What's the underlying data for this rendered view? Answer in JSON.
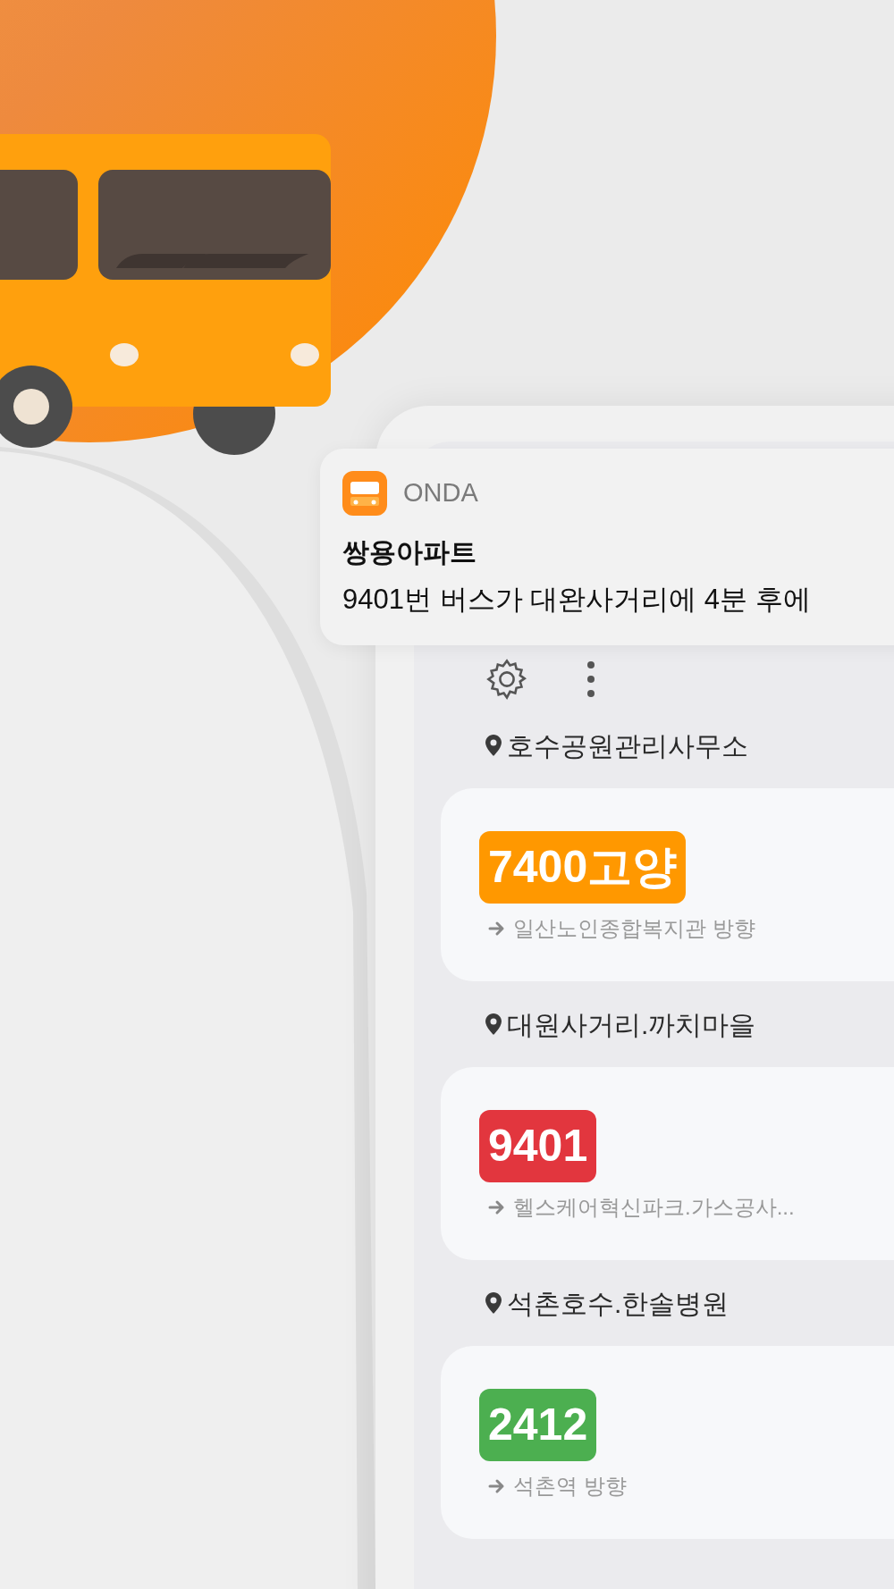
{
  "notification": {
    "app": "ONDA",
    "title": "쌍용아파트",
    "message": "9401번 버스가 대완사거리에 4분 후에"
  },
  "stops": [
    {
      "name": "호수공원관리사무소",
      "route": "7400고양",
      "color": "#ff9800",
      "direction": "일산노인종합복지관 방향"
    },
    {
      "name": "대원사거리.까치마을",
      "route": "9401",
      "color": "#e2363e",
      "direction": "헬스케어혁신파크.가스공사..."
    },
    {
      "name": "석촌호수.한솔병원",
      "route": "2412",
      "color": "#4caf50",
      "direction": "석촌역 방향"
    }
  ]
}
